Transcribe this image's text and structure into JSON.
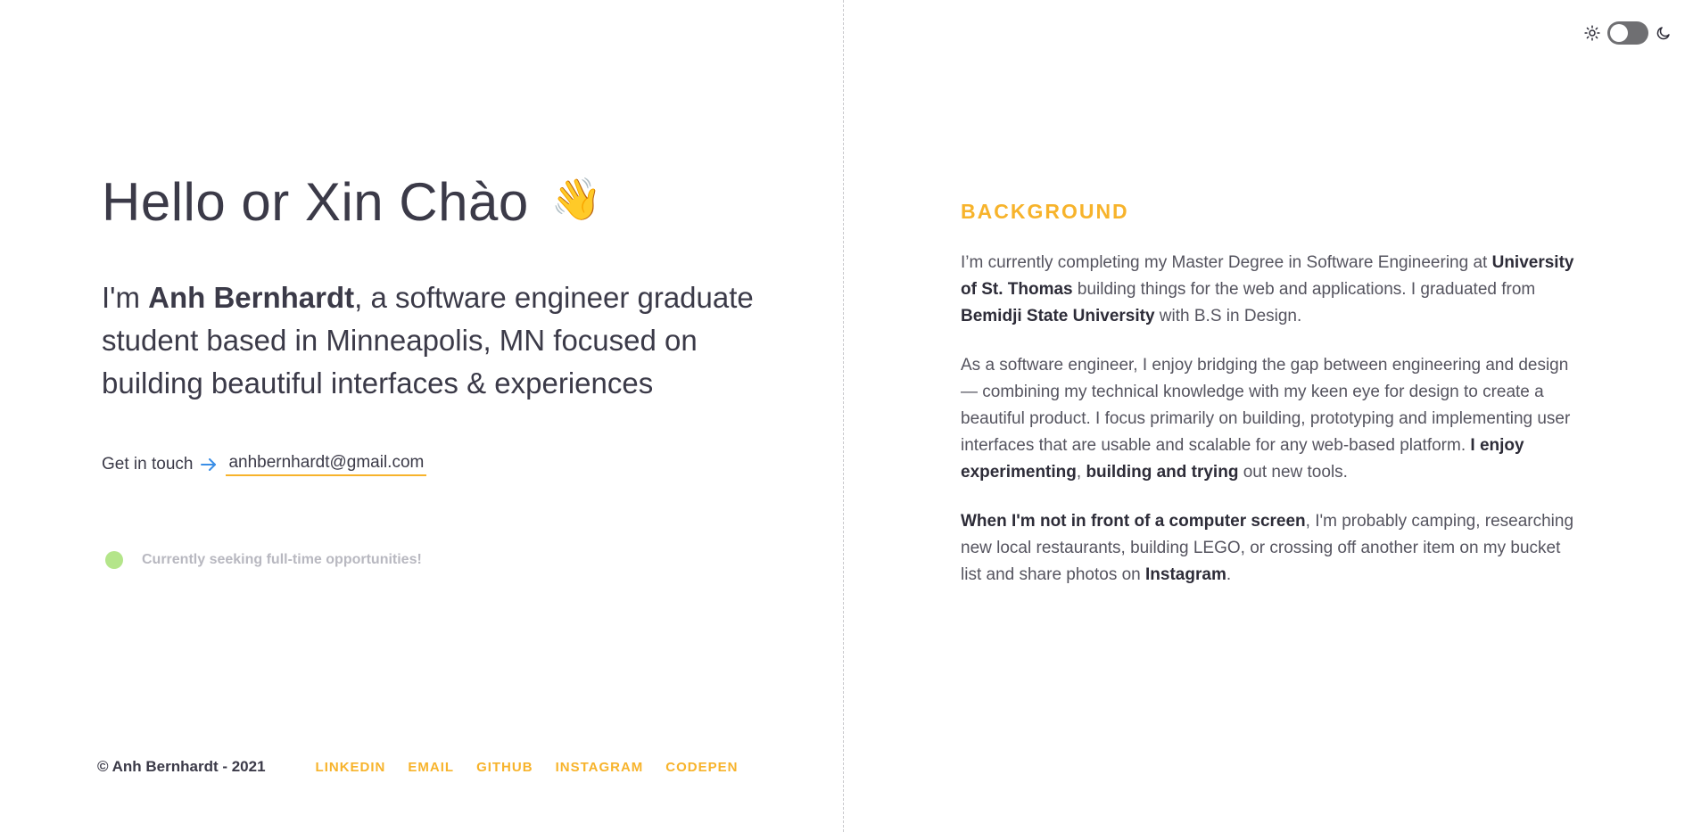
{
  "theme_toggle": {
    "sun_icon": "sun-icon",
    "moon_icon": "moon-icon",
    "state": "light"
  },
  "hero": {
    "greeting": "Hello or Xin Chào",
    "wave_emoji": "👋",
    "intro_prefix": "I'm ",
    "name": "Anh Bernhardt",
    "intro_rest": ", a software engineer graduate student based in Minneapolis, MN focused on building beautiful interfaces & experiences",
    "contact_label": "Get in touch",
    "email": "anhbernhardt@gmail.com",
    "status_text": "Currently seeking full-time opportunities!"
  },
  "footer": {
    "copyright": "© Anh Bernhardt - 2021",
    "links": [
      "LINKEDIN",
      "EMAIL",
      "GITHUB",
      "INSTAGRAM",
      "CODEPEN"
    ]
  },
  "background": {
    "title": "BACKGROUND",
    "p1": {
      "a": "I’m currently completing my Master Degree in Software Engineering at ",
      "b1": "University of St. Thomas",
      "c": " building things for the web and applications. I graduated from ",
      "b2": "Bemidji State University",
      "d": " with B.S in Design."
    },
    "p2": {
      "a": "As a software engineer, I enjoy bridging the gap between engineering and design — combining my technical knowledge with my keen eye for design to create a beautiful product. I focus primarily on building, prototyping and implementing user interfaces that are usable and scalable for any web-based platform. ",
      "b1": "I enjoy experimenting",
      "c": ", ",
      "b2": "building and trying",
      "d": " out new tools."
    },
    "p3": {
      "b1": "When I'm not in front of a computer screen",
      "a": ", I'm probably camping, researching new local restaurants, building LEGO, or crossing off another item on my bucket list and share photos on ",
      "b2": "Instagram",
      "c": "."
    }
  },
  "colors": {
    "accent": "#f7b32b",
    "text": "#3b3a48",
    "status_dot": "#b4e58a",
    "arrow": "#3a8ee6"
  }
}
